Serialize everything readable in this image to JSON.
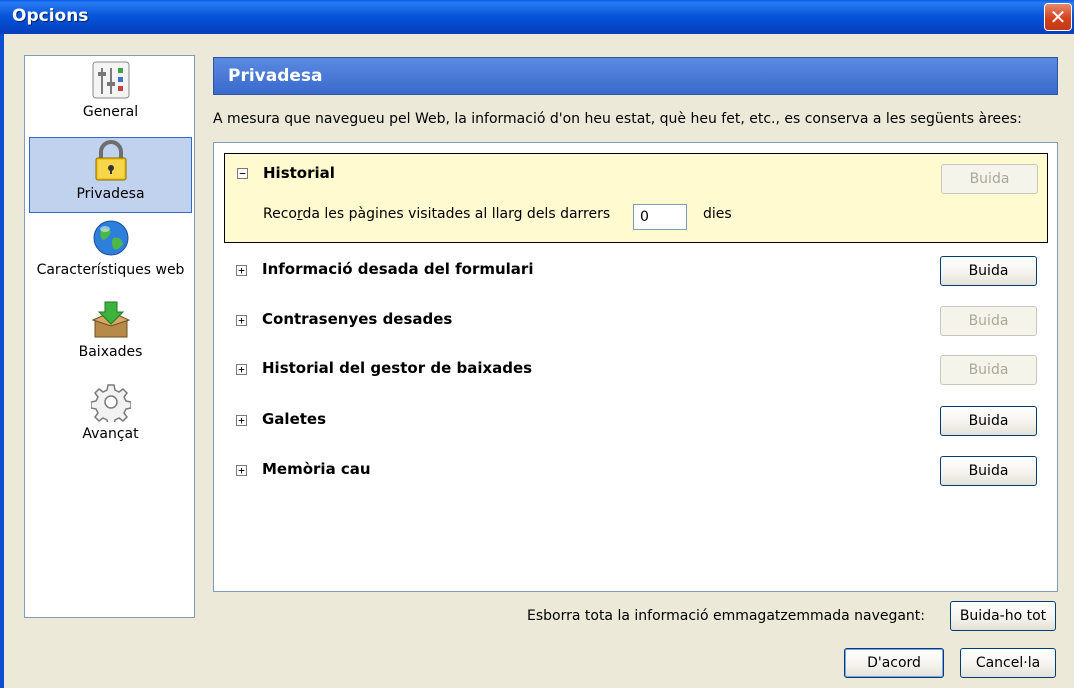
{
  "window": {
    "title": "Opcions",
    "close_symbol": "✕"
  },
  "sidebar": {
    "items": [
      {
        "label": "General",
        "icon": "sliders-icon",
        "selected": false
      },
      {
        "label": "Privadesa",
        "icon": "padlock-icon",
        "selected": true
      },
      {
        "label": "Característiques web",
        "icon": "globe-icon",
        "selected": false
      },
      {
        "label": "Baixades",
        "icon": "download-box-icon",
        "selected": false
      },
      {
        "label": "Avançat",
        "icon": "gear-icon",
        "selected": false
      }
    ]
  },
  "pane": {
    "title": "Privadesa",
    "intro": "A mesura que navegueu pel Web, la informació d'on heu estat, què heu fet, etc., es conserva a les següents àrees:"
  },
  "sections": [
    {
      "label": "Historial",
      "toggle": "−",
      "button": "Buida",
      "button_enabled": false,
      "expanded": true
    },
    {
      "label": "Informació desada del formulari",
      "toggle": "+",
      "button": "Buida",
      "button_enabled": true
    },
    {
      "label": "Contrasenyes desades",
      "toggle": "+",
      "button": "Buida",
      "button_enabled": false
    },
    {
      "label": "Historial del gestor de baixades",
      "toggle": "+",
      "button": "Buida",
      "button_enabled": false
    },
    {
      "label": "Galetes",
      "toggle": "+",
      "button": "Buida",
      "button_enabled": true
    },
    {
      "label": "Memòria cau",
      "toggle": "+",
      "button": "Buida",
      "button_enabled": true
    }
  ],
  "history": {
    "remember_label_pre": "Reco",
    "remember_label_accel": "r",
    "remember_label_post": "da les pàgines visitades al llarg dels darrers",
    "days_value": "0",
    "days_unit": "dies"
  },
  "footer": {
    "clear_all_text": "Esborra tota la informació emmagatzemmada navegant:",
    "clear_all_button": "Buida-ho tot",
    "ok_button": "D'acord",
    "cancel_button": "Cancel·la"
  },
  "colors": {
    "titlebar": "#0756DA",
    "header": "#3A6ACC",
    "selected_nav": "#C1D2EE",
    "expanded_bg": "#FFFACF",
    "window_bg": "#ECE9D8"
  }
}
